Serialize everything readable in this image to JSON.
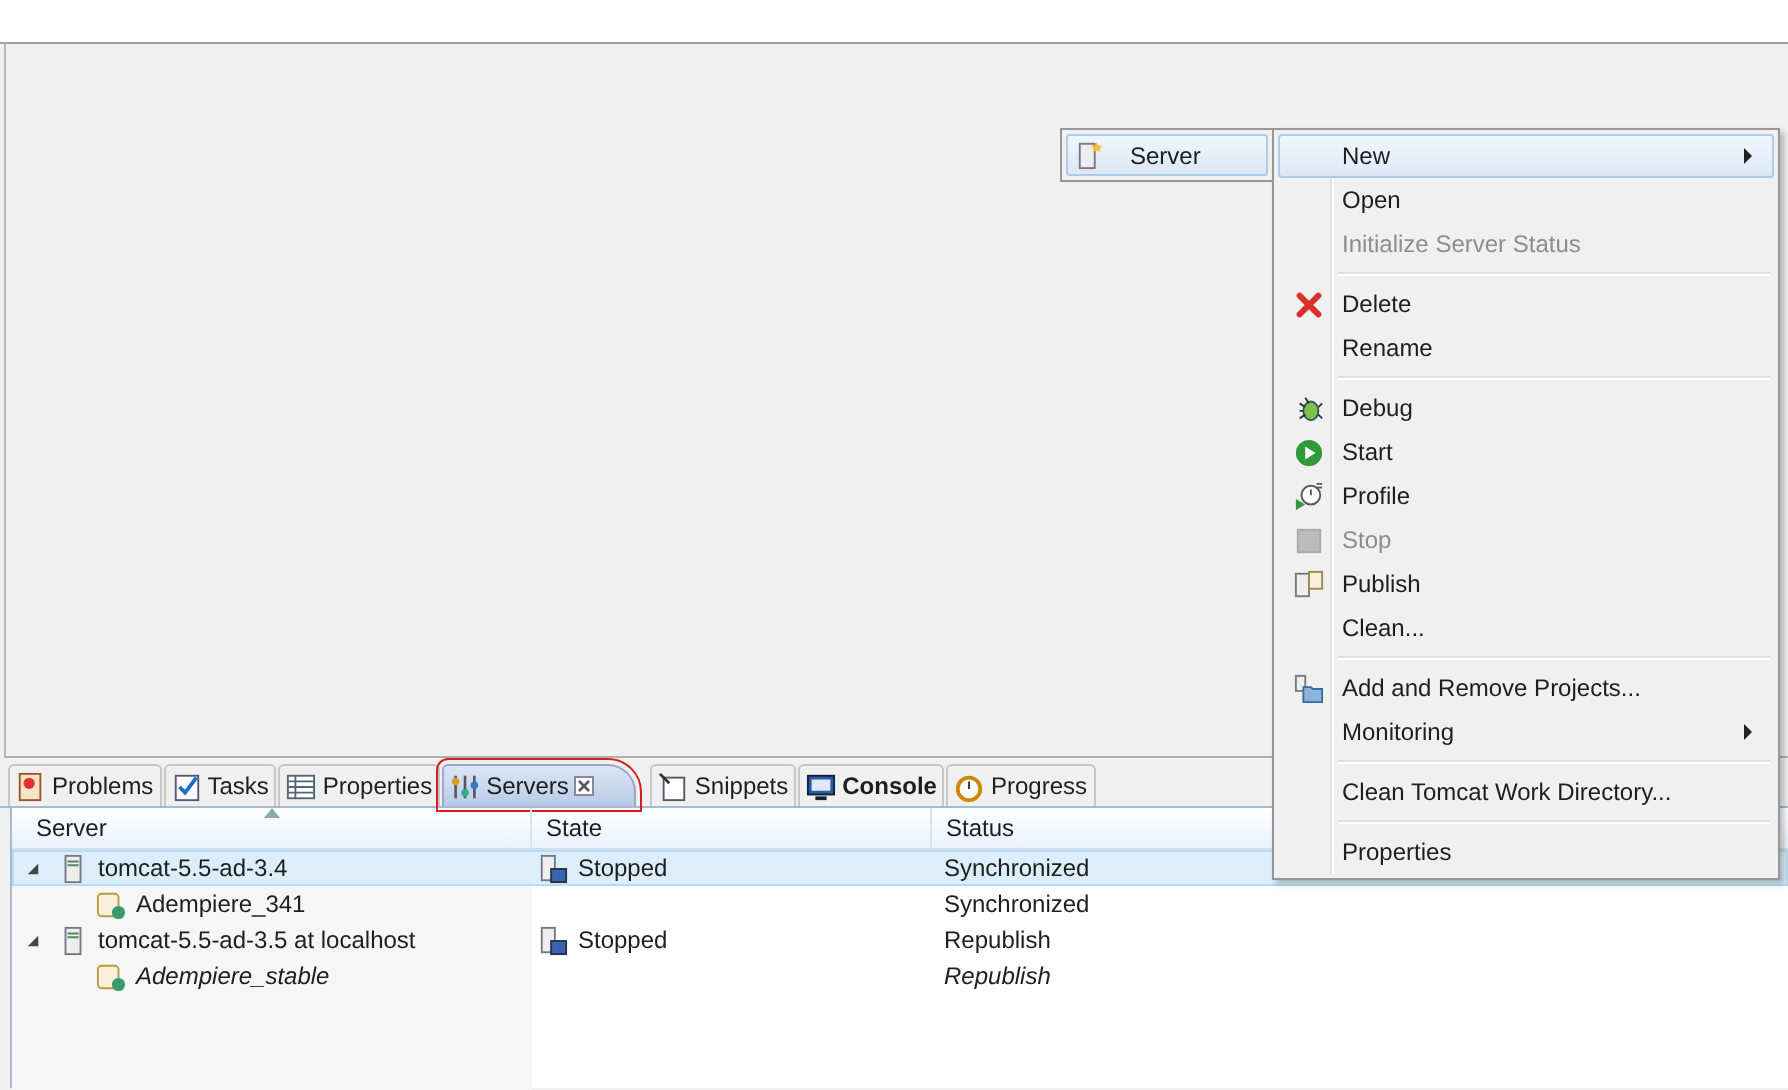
{
  "view_tabs": [
    {
      "label": "Problems",
      "kind": "problems",
      "selected": false,
      "bold": false,
      "closable": false,
      "outlined": false
    },
    {
      "label": "Tasks",
      "kind": "tasks",
      "selected": false,
      "bold": false,
      "closable": false,
      "outlined": false
    },
    {
      "label": "Properties",
      "kind": "properties",
      "selected": false,
      "bold": false,
      "closable": false,
      "outlined": false
    },
    {
      "label": "Servers",
      "kind": "servers",
      "selected": true,
      "bold": false,
      "closable": true,
      "outlined": true
    },
    {
      "label": "Snippets",
      "kind": "snippets",
      "selected": false,
      "bold": false,
      "closable": false,
      "outlined": false
    },
    {
      "label": "Console",
      "kind": "console",
      "selected": false,
      "bold": true,
      "closable": false,
      "outlined": false
    },
    {
      "label": "Progress",
      "kind": "progress",
      "selected": false,
      "bold": false,
      "closable": false,
      "outlined": false
    }
  ],
  "table": {
    "columns": [
      {
        "label": "Server",
        "sorted": true
      },
      {
        "label": "State",
        "sorted": false
      },
      {
        "label": "Status",
        "sorted": false
      }
    ],
    "rows": [
      {
        "name": "tomcat-5.5-ad-3.4",
        "state": "Stopped",
        "status": "Synchronized",
        "expanded": true,
        "selected": true,
        "italic": false,
        "children": [
          {
            "name": "Adempiere_341",
            "status": "Synchronized",
            "selected": false,
            "italic": false
          }
        ]
      },
      {
        "name": "tomcat-5.5-ad-3.5 at localhost",
        "state": "Stopped",
        "status": "Republish",
        "expanded": true,
        "selected": false,
        "italic": false,
        "children": [
          {
            "name": "Adempiere_stable",
            "status": "Republish",
            "selected": false,
            "italic": true
          }
        ]
      }
    ]
  },
  "submenu": {
    "label": "Server"
  },
  "context_menu": [
    [
      {
        "label": "New",
        "kind": "none",
        "disabled": false,
        "submenu": true,
        "selected": true
      },
      {
        "label": "Open",
        "kind": "none",
        "disabled": false,
        "submenu": false,
        "selected": false
      },
      {
        "label": "Initialize Server Status",
        "kind": "none",
        "disabled": true,
        "submenu": false,
        "selected": false
      }
    ],
    [
      {
        "label": "Delete",
        "kind": "delete",
        "disabled": false,
        "submenu": false,
        "selected": false
      },
      {
        "label": "Rename",
        "kind": "none",
        "disabled": false,
        "submenu": false,
        "selected": false
      }
    ],
    [
      {
        "label": "Debug",
        "kind": "debug",
        "disabled": false,
        "submenu": false,
        "selected": false
      },
      {
        "label": "Start",
        "kind": "start",
        "disabled": false,
        "submenu": false,
        "selected": false
      },
      {
        "label": "Profile",
        "kind": "profile",
        "disabled": false,
        "submenu": false,
        "selected": false
      },
      {
        "label": "Stop",
        "kind": "stop",
        "disabled": true,
        "submenu": false,
        "selected": false
      },
      {
        "label": "Publish",
        "kind": "publish",
        "disabled": false,
        "submenu": false,
        "selected": false
      },
      {
        "label": "Clean...",
        "kind": "none",
        "disabled": false,
        "submenu": false,
        "selected": false
      }
    ],
    [
      {
        "label": "Add and Remove Projects...",
        "kind": "projects",
        "disabled": false,
        "submenu": false,
        "selected": false
      },
      {
        "label": "Monitoring",
        "kind": "none",
        "disabled": false,
        "submenu": true,
        "selected": false
      }
    ],
    [
      {
        "label": "Clean Tomcat Work Directory...",
        "kind": "none",
        "disabled": false,
        "submenu": false,
        "selected": false
      }
    ],
    [
      {
        "label": "Properties",
        "kind": "none",
        "disabled": false,
        "submenu": false,
        "selected": false
      }
    ]
  ]
}
